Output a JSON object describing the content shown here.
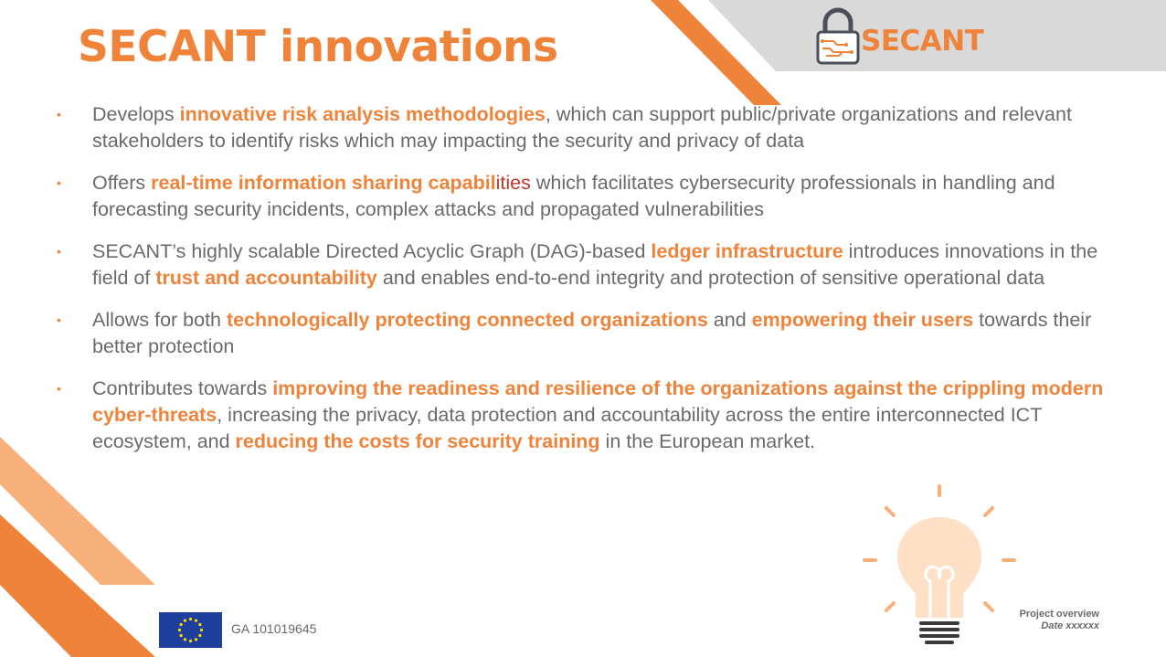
{
  "header": {
    "title": "SECANT innovations",
    "logo_text": "SECANT"
  },
  "bullets": [
    {
      "segments": [
        {
          "text": "Develops ",
          "style": "plain"
        },
        {
          "text": "innovative risk analysis methodologies",
          "style": "hl"
        },
        {
          "text": ", which can support public/private organizations and relevant stakeholders to identify risks  which may impacting the security and privacy of data",
          "style": "plain"
        }
      ]
    },
    {
      "segments": [
        {
          "text": "Offers ",
          "style": "plain"
        },
        {
          "text": "real-time information sharing capabil",
          "style": "hl"
        },
        {
          "text": "ities",
          "style": "hl-red"
        },
        {
          "text": " which facilitates cybersecurity professionals in handling and forecasting security incidents, complex attacks and propagated vulnerabilities",
          "style": "plain"
        }
      ]
    },
    {
      "segments": [
        {
          "text": "SECANT’s highly scalable Directed Acyclic Graph (DAG)-based ",
          "style": "plain"
        },
        {
          "text": "ledger infrastructure",
          "style": "hl"
        },
        {
          "text": " introduces innovations in the field of ",
          "style": "plain"
        },
        {
          "text": "trust and accountability",
          "style": "hl"
        },
        {
          "text": " and enables end-to-end integrity and protection of sensitive operational data",
          "style": "plain"
        }
      ]
    },
    {
      "segments": [
        {
          "text": "Allows for both ",
          "style": "plain"
        },
        {
          "text": "technologically protecting connected organizations",
          "style": "hl"
        },
        {
          "text": " and ",
          "style": "plain"
        },
        {
          "text": "empowering their users",
          "style": "hl"
        },
        {
          "text": " towards their better protection",
          "style": "plain"
        }
      ]
    },
    {
      "segments": [
        {
          "text": "Contributes towards ",
          "style": "plain"
        },
        {
          "text": "improving the readiness and resilience of the organizations against the crippling modern cyber-threats",
          "style": "hl"
        },
        {
          "text": ", increasing the privacy, data protection and accountability across the entire interconnected ICT ecosystem, and ",
          "style": "plain"
        },
        {
          "text": "reducing the costs for security training",
          "style": "hl"
        },
        {
          "text": " in the European market.",
          "style": "plain"
        }
      ]
    }
  ],
  "bullet_marker": "•",
  "footer": {
    "grant": "GA 101019645",
    "line1": "Project overview",
    "line2": "Date xxxxxx"
  },
  "colors": {
    "accent": "#f0833a",
    "accent_light": "#f8b07a",
    "text": "#6a6a6a",
    "header_band": "#d9d9d9",
    "eu_blue": "#1f3f9c",
    "eu_star": "#ffdd00"
  },
  "icons": [
    "padlock-logo-icon",
    "eu-flag-icon",
    "lightbulb-icon"
  ]
}
